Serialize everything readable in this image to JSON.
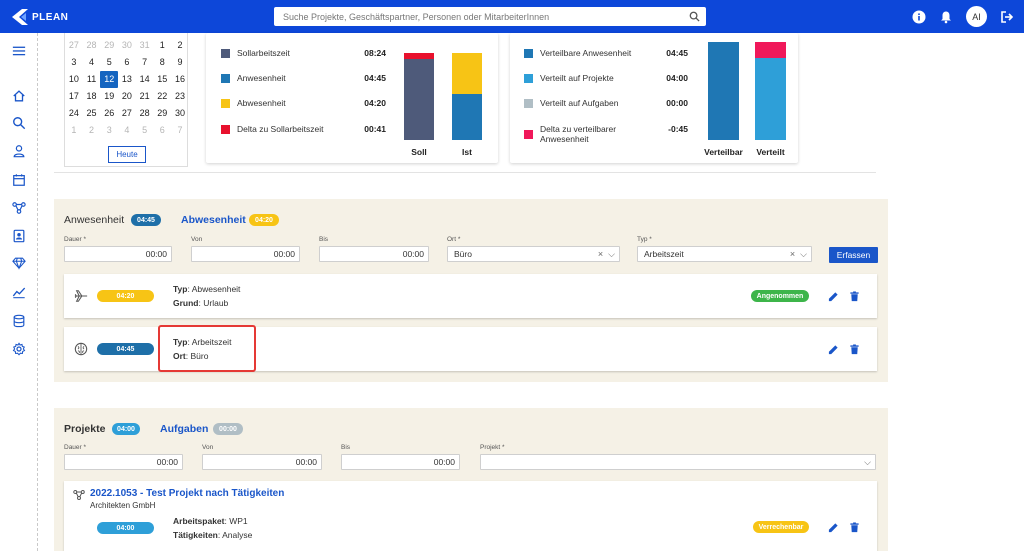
{
  "app": {
    "name": "PLEAN"
  },
  "search": {
    "placeholder": "Suche Projekte, Geschäftspartner, Personen oder MitarbeiterInnen"
  },
  "user": {
    "initials": "AI"
  },
  "calendar": {
    "rows": [
      [
        {
          "d": "27",
          "m": true
        },
        {
          "d": "28",
          "m": true
        },
        {
          "d": "29",
          "m": true
        },
        {
          "d": "30",
          "m": true
        },
        {
          "d": "31",
          "m": true
        },
        {
          "d": "1"
        },
        {
          "d": "2"
        }
      ],
      [
        {
          "d": "3"
        },
        {
          "d": "4"
        },
        {
          "d": "5"
        },
        {
          "d": "6"
        },
        {
          "d": "7"
        },
        {
          "d": "8"
        },
        {
          "d": "9"
        }
      ],
      [
        {
          "d": "10"
        },
        {
          "d": "11"
        },
        {
          "d": "12",
          "s": true
        },
        {
          "d": "13"
        },
        {
          "d": "14"
        },
        {
          "d": "15"
        },
        {
          "d": "16"
        }
      ],
      [
        {
          "d": "17"
        },
        {
          "d": "18"
        },
        {
          "d": "19"
        },
        {
          "d": "20"
        },
        {
          "d": "21"
        },
        {
          "d": "22"
        },
        {
          "d": "23"
        }
      ],
      [
        {
          "d": "24"
        },
        {
          "d": "25"
        },
        {
          "d": "26"
        },
        {
          "d": "27"
        },
        {
          "d": "28"
        },
        {
          "d": "29"
        },
        {
          "d": "30"
        }
      ],
      [
        {
          "d": "1",
          "m": true
        },
        {
          "d": "2",
          "m": true
        },
        {
          "d": "3",
          "m": true
        },
        {
          "d": "4",
          "m": true
        },
        {
          "d": "5",
          "m": true
        },
        {
          "d": "6",
          "m": true
        },
        {
          "d": "7",
          "m": true
        }
      ]
    ],
    "today_label": "Heute"
  },
  "time_stats": {
    "items": [
      {
        "label": "Sollarbeitszeit",
        "value": "08:24",
        "color": "#4e5a7a"
      },
      {
        "label": "Anwesenheit",
        "value": "04:45",
        "color": "#1f77b4"
      },
      {
        "label": "Abwesenheit",
        "value": "04:20",
        "color": "#f7c415"
      },
      {
        "label": "Delta zu Sollarbeitszeit",
        "value": "00:41",
        "color": "#e8112d"
      }
    ],
    "bars": [
      {
        "label": "Soll",
        "segments": [
          {
            "value": 8.4,
            "color": "#4e5a7a"
          },
          {
            "value": 0.68,
            "color": "#e8112d"
          }
        ]
      },
      {
        "label": "Ist",
        "segments": [
          {
            "value": 4.75,
            "color": "#1f77b4"
          },
          {
            "value": 4.33,
            "color": "#f7c415"
          }
        ]
      }
    ]
  },
  "alloc_stats": {
    "items": [
      {
        "label": "Verteilbare Anwesenheit",
        "value": "04:45",
        "color": "#1f77b4"
      },
      {
        "label": "Verteilt auf Projekte",
        "value": "04:00",
        "color": "#2e9fd8"
      },
      {
        "label": "Verteilt auf Aufgaben",
        "value": "00:00",
        "color": "#b0bec5"
      },
      {
        "label": "Delta zu verteilbarer Anwesenheit",
        "value": "-0:45",
        "color": "#f0185a"
      }
    ],
    "bars": [
      {
        "label": "Verteilbar",
        "segments": [
          {
            "value": 4.75,
            "color": "#1f77b4"
          }
        ]
      },
      {
        "label": "Verteilt",
        "segments": [
          {
            "value": 4.0,
            "color": "#2e9fd8"
          },
          {
            "value": 0.75,
            "color": "#f0185a"
          }
        ]
      }
    ]
  },
  "presence": {
    "tab_presence": "Anwesenheit",
    "tab_presence_badge": "04:45",
    "tab_absence": "Abwesenheit",
    "tab_absence_badge": "04:20",
    "form": {
      "duration_label": "Dauer *",
      "duration_value": "00:00",
      "from_label": "Von",
      "from_value": "00:00",
      "to_label": "Bis",
      "to_value": "00:00",
      "location_label": "Ort *",
      "location_value": "Büro",
      "type_label": "Typ *",
      "type_value": "Arbeitszeit",
      "submit": "Erfassen"
    },
    "entries": [
      {
        "duration": "04:20",
        "type_key": "Typ",
        "type": "Abwesenheit",
        "second_key": "Grund",
        "second": "Urlaub",
        "status": "Angenommen"
      },
      {
        "duration": "04:45",
        "type_key": "Typ",
        "type": "Arbeitszeit",
        "second_key": "Ort",
        "second": "Büro"
      }
    ]
  },
  "projects": {
    "tab_projects": "Projekte",
    "tab_projects_badge": "04:00",
    "tab_tasks": "Aufgaben",
    "tab_tasks_badge": "00:00",
    "form": {
      "duration_label": "Dauer *",
      "duration_value": "00:00",
      "from_label": "Von",
      "from_value": "00:00",
      "to_label": "Bis",
      "to_value": "00:00",
      "project_label": "Projekt *",
      "project_value": ""
    },
    "entry": {
      "title": "2022.1053 - Test Projekt nach Tätigkeiten",
      "company": "Architekten GmbH",
      "duration": "04:00",
      "package_key": "Arbeitspaket",
      "package": "WP1",
      "activity_key": "Tätigkeiten",
      "activity": "Analyse",
      "status": "Verrechenbar"
    }
  },
  "colors": {
    "primary": "#0d47d9",
    "link": "#1a56c9",
    "section_bg": "#f5f1e6",
    "presence_badge": "#1e6fa8",
    "absence_badge": "#f7c415",
    "accepted": "#3db54a",
    "billable": "#f7c415",
    "highlight": "#e53935"
  }
}
